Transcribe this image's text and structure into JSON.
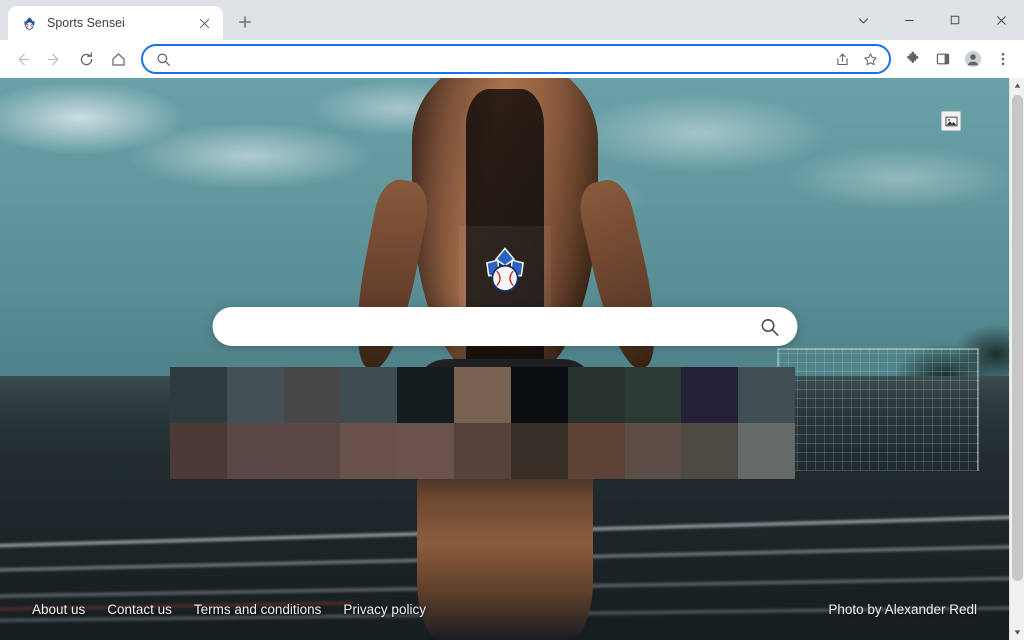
{
  "browser": {
    "tab": {
      "title": "Sports Sensei",
      "favicon_name": "sports-sensei-favicon",
      "close_label": "×"
    },
    "new_tab_label": "+",
    "window_controls": {
      "tab_search_label": "⌄",
      "minimize_label": "–",
      "maximize_label": "□",
      "close_label": "✕"
    },
    "nav": {
      "back_label": "←",
      "forward_label": "→",
      "reload_label": "⟳",
      "home_label": "⌂"
    },
    "omnibox": {
      "value": "",
      "placeholder": "",
      "search_icon": "search-icon",
      "share_icon": "share-icon",
      "bookmark_icon": "star-icon"
    },
    "toolbar_icons": {
      "extensions": "puzzle-piece-icon",
      "side_panel": "side-panel-icon",
      "profile": "profile-avatar-icon",
      "menu": "three-dot-menu-icon"
    },
    "accent_color": "#1a73e8"
  },
  "page": {
    "logo_name": "sports-sensei-logo",
    "image_badge_name": "image-placeholder-icon",
    "search": {
      "value": "",
      "placeholder": "",
      "icon_name": "search-icon"
    },
    "censored_region": {
      "label": "pixelated-content-block",
      "columns": 11,
      "rows": 2,
      "colors": [
        "#2d3b3e",
        "#434f54",
        "#474747",
        "#3e4b50",
        "#151d1f",
        "#7a6253",
        "#0a0e11",
        "#28332f",
        "#2c3a36",
        "#251f38",
        "#404f54",
        "#4b3a36",
        "#594745",
        "#5a4744",
        "#68514b",
        "#6b534d",
        "#56423a",
        "#383028",
        "#5d4335",
        "#5a4e46",
        "#4e4a42",
        "#646a68"
      ]
    },
    "footer": {
      "links": [
        {
          "label": "About us"
        },
        {
          "label": "Contact us"
        },
        {
          "label": "Terms and conditions"
        },
        {
          "label": "Privacy policy"
        }
      ],
      "credit": "Photo by Alexander Redl"
    }
  },
  "scrollbar": {
    "up_arrow": "▲",
    "down_arrow": "▼"
  }
}
